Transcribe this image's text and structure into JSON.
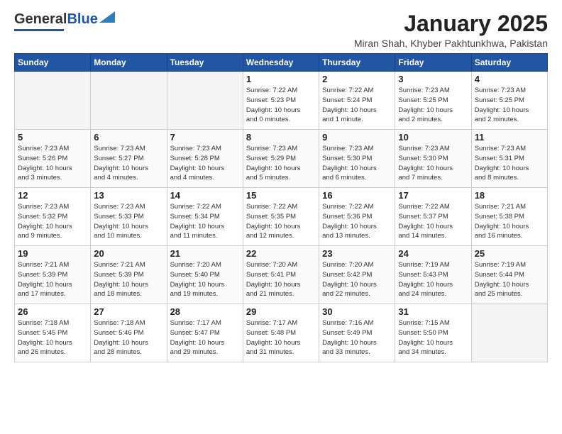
{
  "header": {
    "logo_general": "General",
    "logo_blue": "Blue",
    "title": "January 2025",
    "subtitle": "Miran Shah, Khyber Pakhtunkhwa, Pakistan"
  },
  "days_of_week": [
    "Sunday",
    "Monday",
    "Tuesday",
    "Wednesday",
    "Thursday",
    "Friday",
    "Saturday"
  ],
  "weeks": [
    [
      {
        "num": "",
        "info": ""
      },
      {
        "num": "",
        "info": ""
      },
      {
        "num": "",
        "info": ""
      },
      {
        "num": "1",
        "info": "Sunrise: 7:22 AM\nSunset: 5:23 PM\nDaylight: 10 hours\nand 0 minutes."
      },
      {
        "num": "2",
        "info": "Sunrise: 7:22 AM\nSunset: 5:24 PM\nDaylight: 10 hours\nand 1 minute."
      },
      {
        "num": "3",
        "info": "Sunrise: 7:23 AM\nSunset: 5:25 PM\nDaylight: 10 hours\nand 2 minutes."
      },
      {
        "num": "4",
        "info": "Sunrise: 7:23 AM\nSunset: 5:25 PM\nDaylight: 10 hours\nand 2 minutes."
      }
    ],
    [
      {
        "num": "5",
        "info": "Sunrise: 7:23 AM\nSunset: 5:26 PM\nDaylight: 10 hours\nand 3 minutes."
      },
      {
        "num": "6",
        "info": "Sunrise: 7:23 AM\nSunset: 5:27 PM\nDaylight: 10 hours\nand 4 minutes."
      },
      {
        "num": "7",
        "info": "Sunrise: 7:23 AM\nSunset: 5:28 PM\nDaylight: 10 hours\nand 4 minutes."
      },
      {
        "num": "8",
        "info": "Sunrise: 7:23 AM\nSunset: 5:29 PM\nDaylight: 10 hours\nand 5 minutes."
      },
      {
        "num": "9",
        "info": "Sunrise: 7:23 AM\nSunset: 5:30 PM\nDaylight: 10 hours\nand 6 minutes."
      },
      {
        "num": "10",
        "info": "Sunrise: 7:23 AM\nSunset: 5:30 PM\nDaylight: 10 hours\nand 7 minutes."
      },
      {
        "num": "11",
        "info": "Sunrise: 7:23 AM\nSunset: 5:31 PM\nDaylight: 10 hours\nand 8 minutes."
      }
    ],
    [
      {
        "num": "12",
        "info": "Sunrise: 7:23 AM\nSunset: 5:32 PM\nDaylight: 10 hours\nand 9 minutes."
      },
      {
        "num": "13",
        "info": "Sunrise: 7:23 AM\nSunset: 5:33 PM\nDaylight: 10 hours\nand 10 minutes."
      },
      {
        "num": "14",
        "info": "Sunrise: 7:22 AM\nSunset: 5:34 PM\nDaylight: 10 hours\nand 11 minutes."
      },
      {
        "num": "15",
        "info": "Sunrise: 7:22 AM\nSunset: 5:35 PM\nDaylight: 10 hours\nand 12 minutes."
      },
      {
        "num": "16",
        "info": "Sunrise: 7:22 AM\nSunset: 5:36 PM\nDaylight: 10 hours\nand 13 minutes."
      },
      {
        "num": "17",
        "info": "Sunrise: 7:22 AM\nSunset: 5:37 PM\nDaylight: 10 hours\nand 14 minutes."
      },
      {
        "num": "18",
        "info": "Sunrise: 7:21 AM\nSunset: 5:38 PM\nDaylight: 10 hours\nand 16 minutes."
      }
    ],
    [
      {
        "num": "19",
        "info": "Sunrise: 7:21 AM\nSunset: 5:39 PM\nDaylight: 10 hours\nand 17 minutes."
      },
      {
        "num": "20",
        "info": "Sunrise: 7:21 AM\nSunset: 5:39 PM\nDaylight: 10 hours\nand 18 minutes."
      },
      {
        "num": "21",
        "info": "Sunrise: 7:20 AM\nSunset: 5:40 PM\nDaylight: 10 hours\nand 19 minutes."
      },
      {
        "num": "22",
        "info": "Sunrise: 7:20 AM\nSunset: 5:41 PM\nDaylight: 10 hours\nand 21 minutes."
      },
      {
        "num": "23",
        "info": "Sunrise: 7:20 AM\nSunset: 5:42 PM\nDaylight: 10 hours\nand 22 minutes."
      },
      {
        "num": "24",
        "info": "Sunrise: 7:19 AM\nSunset: 5:43 PM\nDaylight: 10 hours\nand 24 minutes."
      },
      {
        "num": "25",
        "info": "Sunrise: 7:19 AM\nSunset: 5:44 PM\nDaylight: 10 hours\nand 25 minutes."
      }
    ],
    [
      {
        "num": "26",
        "info": "Sunrise: 7:18 AM\nSunset: 5:45 PM\nDaylight: 10 hours\nand 26 minutes."
      },
      {
        "num": "27",
        "info": "Sunrise: 7:18 AM\nSunset: 5:46 PM\nDaylight: 10 hours\nand 28 minutes."
      },
      {
        "num": "28",
        "info": "Sunrise: 7:17 AM\nSunset: 5:47 PM\nDaylight: 10 hours\nand 29 minutes."
      },
      {
        "num": "29",
        "info": "Sunrise: 7:17 AM\nSunset: 5:48 PM\nDaylight: 10 hours\nand 31 minutes."
      },
      {
        "num": "30",
        "info": "Sunrise: 7:16 AM\nSunset: 5:49 PM\nDaylight: 10 hours\nand 33 minutes."
      },
      {
        "num": "31",
        "info": "Sunrise: 7:15 AM\nSunset: 5:50 PM\nDaylight: 10 hours\nand 34 minutes."
      },
      {
        "num": "",
        "info": ""
      }
    ]
  ]
}
